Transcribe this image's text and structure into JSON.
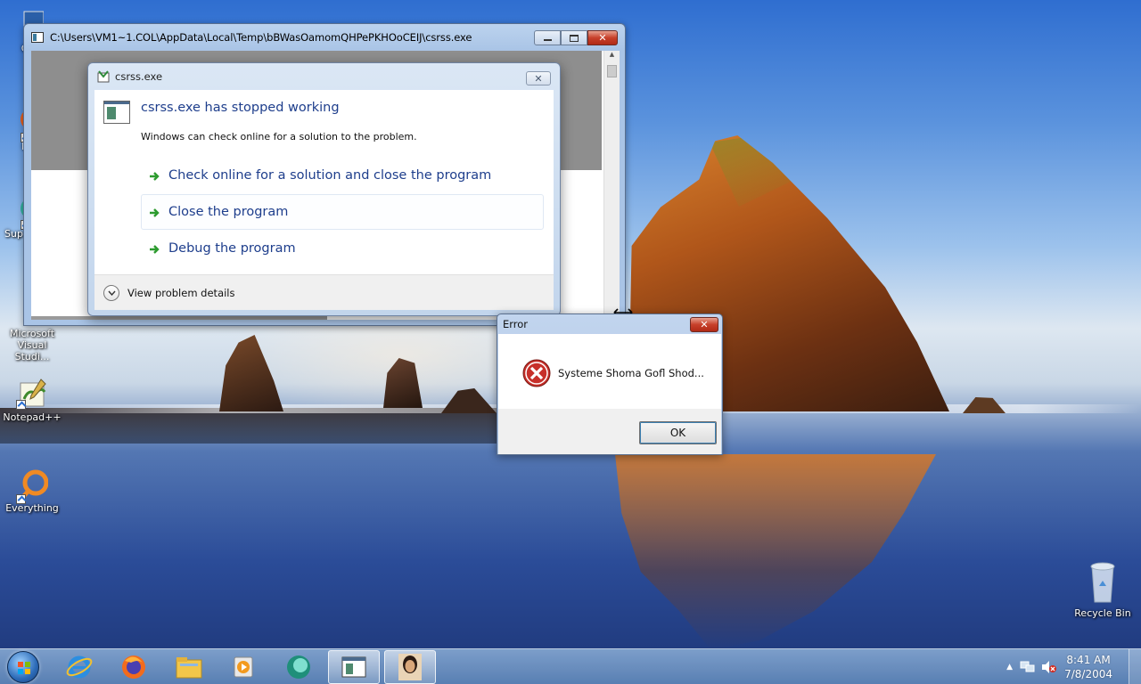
{
  "desktop": {
    "icons": [
      {
        "label": "Co",
        "icon": "computer-icon"
      },
      {
        "label": "F",
        "icon": "firefox-icon"
      },
      {
        "label": "Sup",
        "icon": "support-icon"
      },
      {
        "label": "Microsoft Visual Studi...",
        "icon": "visual-studio-icon"
      },
      {
        "label": "Notepad++",
        "icon": "notepad-plus-plus-icon"
      },
      {
        "label": "Everything",
        "icon": "everything-search-icon"
      },
      {
        "label": "Recycle Bin",
        "icon": "recycle-bin-icon"
      }
    ]
  },
  "console_window": {
    "title": "C:\\Users\\VM1~1.COL\\AppData\\Local\\Temp\\bBWasOamomQHPePKHOoCEIJ\\csrss.exe"
  },
  "wer_dialog": {
    "title": "csrss.exe",
    "heading": "csrss.exe has stopped working",
    "subtext": "Windows can check online for a solution to the problem.",
    "options": [
      "Check online for a solution and close the program",
      "Close the program",
      "Debug the program"
    ],
    "details_label": "View problem details"
  },
  "error_dialog": {
    "title": "Error",
    "message": "Systeme Shoma Gofl Shod...",
    "ok_label": "OK"
  },
  "taskbar": {
    "pinned": [
      "internet-explorer-icon",
      "firefox-icon",
      "explorer-folder-icon",
      "media-player-icon",
      "chat-app-icon",
      "console-app-icon",
      "user-photo-icon"
    ],
    "time": "8:41 AM",
    "date": "7/8/2004"
  },
  "colors": {
    "link_blue": "#1e3e8c",
    "arrow_green": "#2d9b2f",
    "error_red": "#c7302a"
  }
}
